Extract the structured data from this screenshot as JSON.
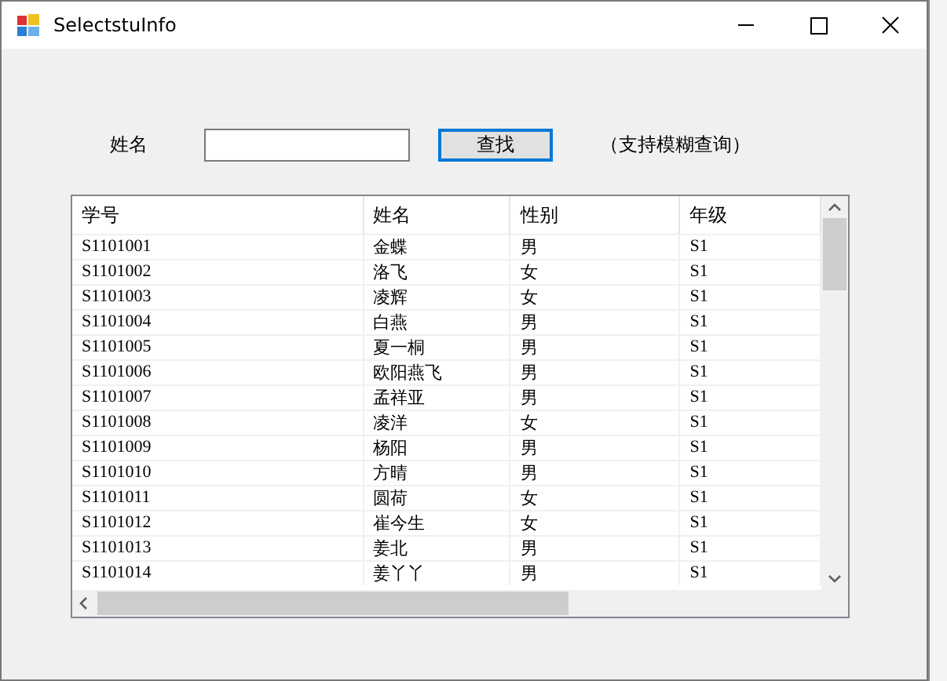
{
  "window": {
    "title": "SelectstuInfo"
  },
  "search": {
    "label": "姓名",
    "button": "查找",
    "hint": "（支持模糊查询）"
  },
  "table": {
    "columns": [
      "学号",
      "姓名",
      "性别",
      "年级"
    ],
    "rows": [
      [
        "S1101001",
        "金蝶",
        "男",
        "S1"
      ],
      [
        "S1101002",
        "洛飞",
        "女",
        "S1"
      ],
      [
        "S1101003",
        "凌辉",
        "女",
        "S1"
      ],
      [
        "S1101004",
        "白燕",
        "男",
        "S1"
      ],
      [
        "S1101005",
        "夏一桐",
        "男",
        "S1"
      ],
      [
        "S1101006",
        "欧阳燕飞",
        "男",
        "S1"
      ],
      [
        "S1101007",
        "孟祥亚",
        "男",
        "S1"
      ],
      [
        "S1101008",
        "凌洋",
        "女",
        "S1"
      ],
      [
        "S1101009",
        "杨阳",
        "男",
        "S1"
      ],
      [
        "S1101010",
        "方晴",
        "男",
        "S1"
      ],
      [
        "S1101011",
        "圆荷",
        "女",
        "S1"
      ],
      [
        "S1101012",
        "崔今生",
        "女",
        "S1"
      ],
      [
        "S1101013",
        "姜北",
        "男",
        "S1"
      ],
      [
        "S1101014",
        "姜丫丫",
        "男",
        "S1"
      ]
    ]
  }
}
